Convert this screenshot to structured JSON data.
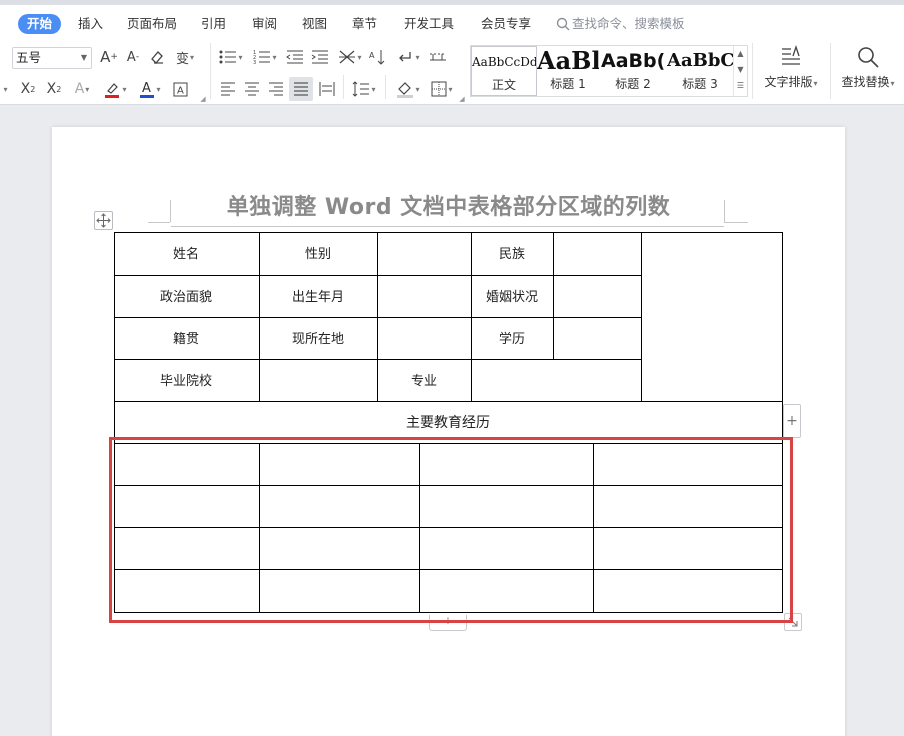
{
  "menu": {
    "items": [
      "开始",
      "插入",
      "页面布局",
      "引用",
      "审阅",
      "视图",
      "章节",
      "开发工具",
      "会员专享"
    ],
    "active_index": 0,
    "search_placeholder": "查找命令、搜索模板"
  },
  "ribbon": {
    "font_size": "五号",
    "styles": [
      {
        "sample": "AaBbCcDd",
        "name": "正文"
      },
      {
        "sample": "AaBl",
        "name": "标题 1"
      },
      {
        "sample": "AaBb(",
        "name": "标题 2"
      },
      {
        "sample": "AaBbC",
        "name": "标题 3"
      }
    ],
    "text_layout_label": "文字排版",
    "find_replace_label": "查找替换",
    "font_color": "#e02020",
    "highlight_color": "#e02020",
    "text_color_accent": "#2050d0"
  },
  "document": {
    "title": "单独调整 Word 文档中表格部分区域的列数",
    "table": {
      "row1": [
        "姓名",
        "性别",
        "",
        "民族",
        ""
      ],
      "row2": [
        "政治面貌",
        "出生年月",
        "",
        "婚姻状况",
        ""
      ],
      "row3": [
        "籍贯",
        "现所在地",
        "",
        "学历",
        ""
      ],
      "row4": [
        "毕业院校",
        "",
        "专业",
        ""
      ],
      "section_header": "主要教育经历",
      "education_rows": [
        [
          "",
          "",
          "",
          ""
        ],
        [
          "",
          "",
          "",
          ""
        ],
        [
          "",
          "",
          "",
          ""
        ],
        [
          "",
          "",
          "",
          ""
        ]
      ]
    },
    "add_column_symbol": "+",
    "add_row_symbol": "+",
    "highlight_color": "#d84343"
  }
}
